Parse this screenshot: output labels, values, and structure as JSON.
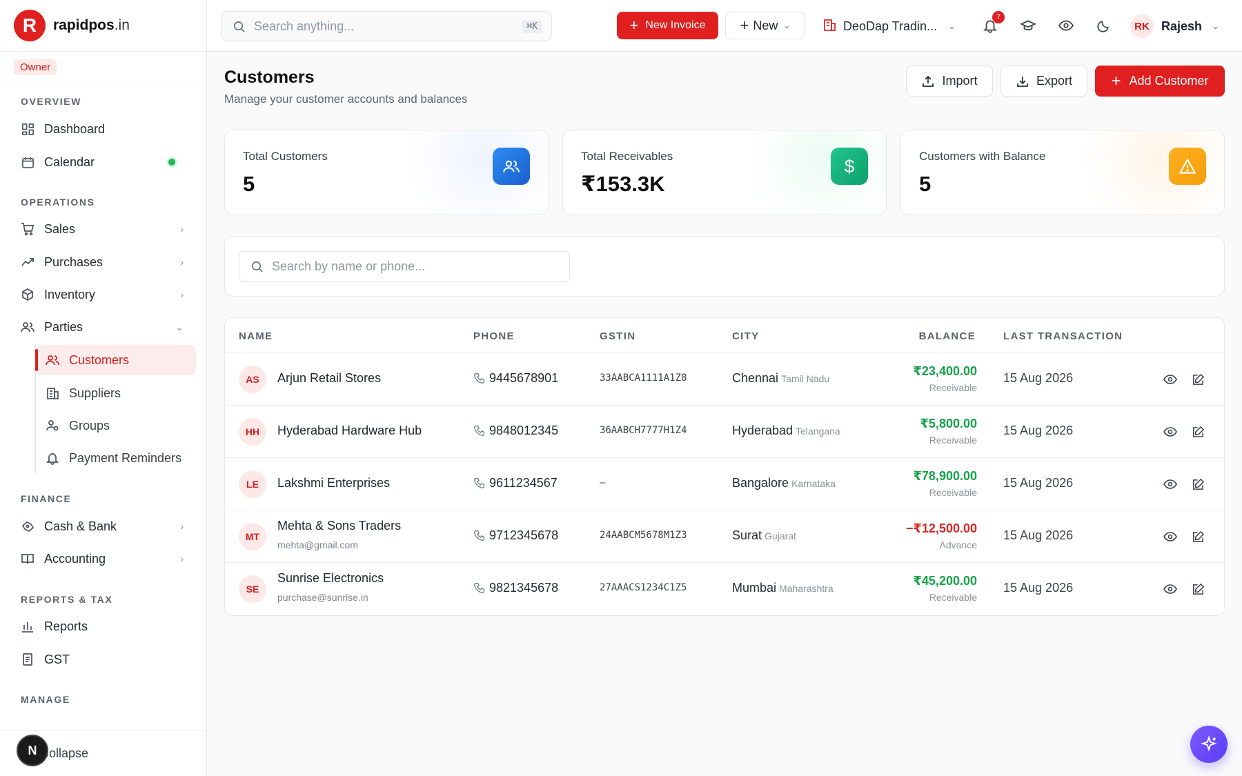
{
  "brand": {
    "name": "rapidpos",
    "tld": ".in",
    "mark": "R"
  },
  "role": "Owner",
  "sidebar": {
    "sections": {
      "overview": "OVERVIEW",
      "operations": "OPERATIONS",
      "finance": "FINANCE",
      "reports": "REPORTS & TAX",
      "manage": "MANAGE"
    },
    "items": {
      "dashboard": "Dashboard",
      "calendar": "Calendar",
      "sales": "Sales",
      "purchases": "Purchases",
      "inventory": "Inventory",
      "parties": "Parties",
      "customers": "Customers",
      "suppliers": "Suppliers",
      "groups": "Groups",
      "payment_reminders": "Payment Reminders",
      "cash_bank": "Cash & Bank",
      "accounting": "Accounting",
      "reports": "Reports",
      "gst": "GST"
    },
    "collapse": "Collapse",
    "dev_badge": "N"
  },
  "topbar": {
    "search_placeholder": "Search anything...",
    "search_shortcut": "⌘K",
    "new_invoice": "New Invoice",
    "new": "New",
    "company": "DeoDap Tradin...",
    "notifications_count": "7",
    "user_initials": "RK",
    "user_name": "Rajesh"
  },
  "page": {
    "title": "Customers",
    "subtitle": "Manage your customer accounts and balances",
    "import": "Import",
    "export": "Export",
    "add_customer": "Add Customer"
  },
  "stats": [
    {
      "label": "Total Customers",
      "value": "5",
      "color": "#1a73e8"
    },
    {
      "label": "Total Receivables",
      "value": "₹153.3K",
      "color": "#10b981"
    },
    {
      "label": "Customers with Balance",
      "value": "5",
      "color": "#f59e0b"
    }
  ],
  "filter": {
    "placeholder": "Search by name or phone..."
  },
  "table": {
    "headers": {
      "name": "NAME",
      "phone": "PHONE",
      "gstin": "GSTIN",
      "city": "CITY",
      "balance": "BALANCE",
      "last_transaction": "LAST TRANSACTION"
    },
    "rows": [
      {
        "initials": "AS",
        "name": "Arjun Retail Stores",
        "email": "",
        "phone": "9445678901",
        "gstin": "33AABCA1111A1Z8",
        "city": "Chennai",
        "state": "Tamil Nadu",
        "balance": "₹23,400.00",
        "balance_type": "Receivable",
        "balance_color": "#16a34a",
        "last": "15 Aug 2026"
      },
      {
        "initials": "HH",
        "name": "Hyderabad Hardware Hub",
        "email": "",
        "phone": "9848012345",
        "gstin": "36AABCH7777H1Z4",
        "city": "Hyderabad",
        "state": "Telangana",
        "balance": "₹5,800.00",
        "balance_type": "Receivable",
        "balance_color": "#16a34a",
        "last": "15 Aug 2026"
      },
      {
        "initials": "LE",
        "name": "Lakshmi Enterprises",
        "email": "",
        "phone": "9611234567",
        "gstin": "—",
        "city": "Bangalore",
        "state": "Karnataka",
        "balance": "₹78,900.00",
        "balance_type": "Receivable",
        "balance_color": "#16a34a",
        "last": "15 Aug 2026"
      },
      {
        "initials": "MT",
        "name": "Mehta & Sons Traders",
        "email": "mehta@gmail.com",
        "phone": "9712345678",
        "gstin": "24AABCM5678M1Z3",
        "city": "Surat",
        "state": "Gujarat",
        "balance": "−₹12,500.00",
        "balance_type": "Advance",
        "balance_color": "#dc2626",
        "last": "15 Aug 2026"
      },
      {
        "initials": "SE",
        "name": "Sunrise Electronics",
        "email": "purchase@sunrise.in",
        "phone": "9821345678",
        "gstin": "27AAACS1234C1Z5",
        "city": "Mumbai",
        "state": "Maharashtra",
        "balance": "₹45,200.00",
        "balance_type": "Receivable",
        "balance_color": "#16a34a",
        "last": "15 Aug 2026"
      }
    ]
  },
  "colors": {
    "accent": "#e02020",
    "receivable": "#16a34a",
    "advance": "#dc2626"
  }
}
